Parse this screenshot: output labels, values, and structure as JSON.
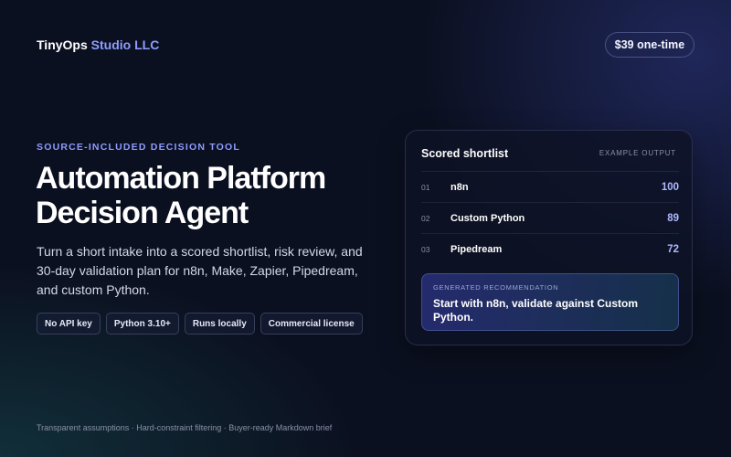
{
  "brand": {
    "name": "TinyOps",
    "accent": "Studio LLC"
  },
  "price": "$39 one-time",
  "hero": {
    "eyebrow": "SOURCE-INCLUDED DECISION TOOL",
    "title_line1": "Automation Platform",
    "title_line2": "Decision Agent",
    "description": "Turn a short intake into a scored shortlist, risk review, and 30-day validation plan for n8n, Make, Zapier, Pipedream, and custom Python.",
    "tags": [
      "No API key",
      "Python 3.10+",
      "Runs locally",
      "Commercial license"
    ]
  },
  "card": {
    "title": "Scored shortlist",
    "label": "EXAMPLE OUTPUT",
    "rows": [
      {
        "rank": "01",
        "name": "n8n",
        "score": "100"
      },
      {
        "rank": "02",
        "name": "Custom Python",
        "score": "89"
      },
      {
        "rank": "03",
        "name": "Pipedream",
        "score": "72"
      }
    ],
    "recommendation_label": "GENERATED RECOMMENDATION",
    "recommendation": "Start with n8n, validate against Custom Python."
  },
  "footer": "Transparent assumptions · Hard-constraint filtering · Buyer-ready Markdown brief",
  "colors": {
    "accent": "#8e9cff",
    "background": "#0b1020",
    "score": "#aeb8ff"
  }
}
